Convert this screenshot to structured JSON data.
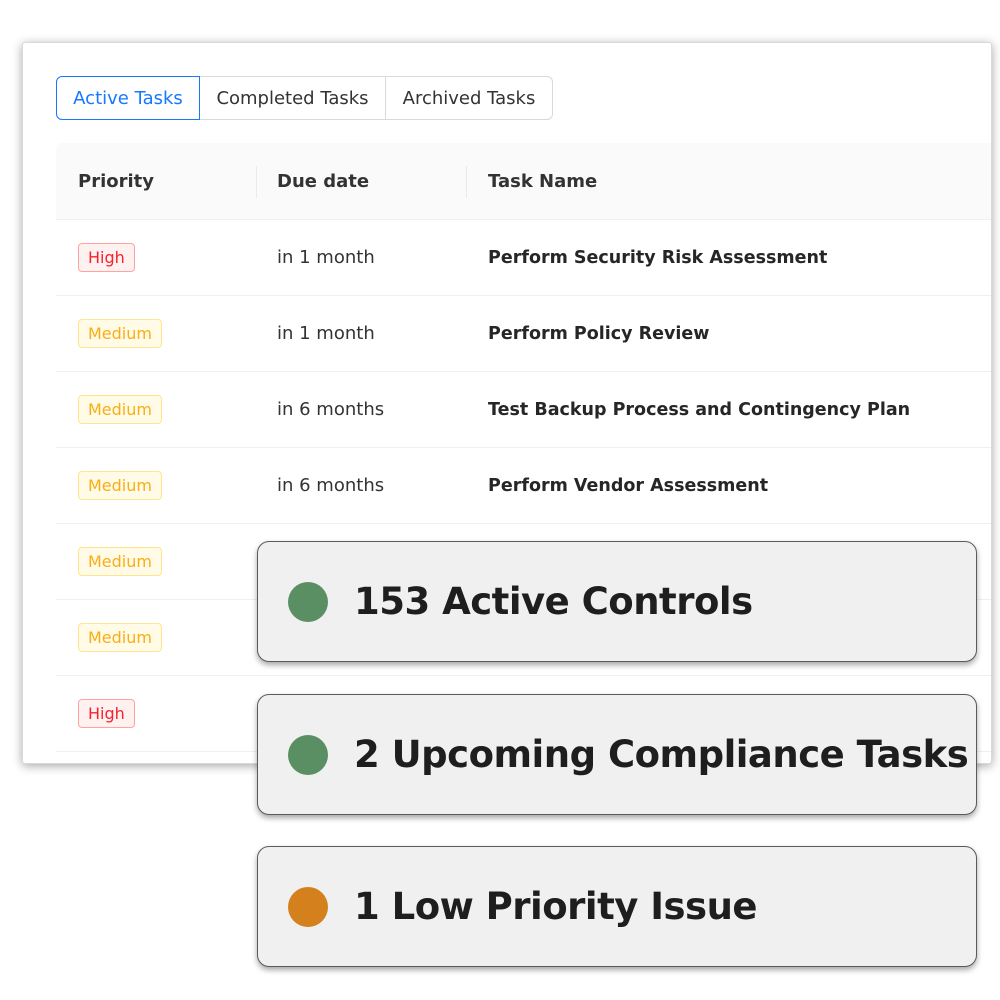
{
  "tabs": [
    {
      "label": "Active Tasks",
      "active": true
    },
    {
      "label": "Completed Tasks",
      "active": false
    },
    {
      "label": "Archived Tasks",
      "active": false
    }
  ],
  "table": {
    "headers": {
      "priority": "Priority",
      "due_date": "Due date",
      "task_name": "Task Name"
    },
    "rows": [
      {
        "priority": "High",
        "level": "high",
        "due": "in 1 month",
        "task": "Perform Security Risk Assessment"
      },
      {
        "priority": "Medium",
        "level": "medium",
        "due": "in 1 month",
        "task": "Perform Policy Review"
      },
      {
        "priority": "Medium",
        "level": "medium",
        "due": "in 6 months",
        "task": "Test Backup Process and Contingency Plan"
      },
      {
        "priority": "Medium",
        "level": "medium",
        "due": "in 6 months",
        "task": "Perform Vendor Assessment"
      },
      {
        "priority": "Medium",
        "level": "medium",
        "due": "",
        "task": ""
      },
      {
        "priority": "Medium",
        "level": "medium",
        "due": "",
        "task": ""
      },
      {
        "priority": "High",
        "level": "high",
        "due": "",
        "task": ""
      }
    ]
  },
  "callouts": [
    {
      "label": "153 Active Controls",
      "dot_color": "#5a8f63"
    },
    {
      "label": "2 Upcoming Compliance Tasks",
      "dot_color": "#5a8f63"
    },
    {
      "label": "1 Low Priority Issue",
      "dot_color": "#d4801c"
    }
  ],
  "colors": {
    "accent": "#1677ff",
    "high_text": "#f5222d",
    "medium_text": "#faad14"
  }
}
